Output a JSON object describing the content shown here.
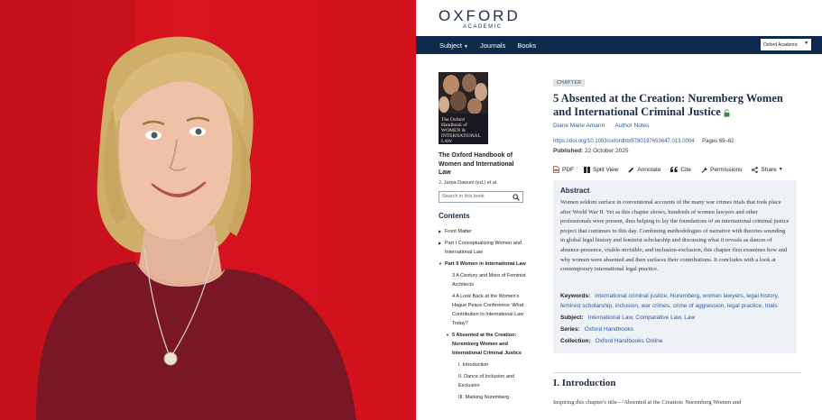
{
  "brand": {
    "logo": "OXFORD",
    "logo_sub": "ACADEMIC"
  },
  "nav": {
    "subject": "Subject",
    "journals": "Journals",
    "books": "Books",
    "site_select": "Oxford Academic"
  },
  "book": {
    "cover_title": "The Oxford Handbook of WOMEN & INTERNATIONAL LAW",
    "title": "The Oxford Handbook of Women and International Law",
    "editors": "J. Jarpa Dawuni (ed.) et al."
  },
  "search": {
    "placeholder": "Search in this book"
  },
  "contents": {
    "heading": "Contents",
    "front_matter": "Front Matter",
    "part1": "Part I  Conceptualizing Women and International Law",
    "part2": "Part II  Women in International Law",
    "ch3": "3  A Century and More of Feminist Architects",
    "ch4": "4  A Look Back at the Women's Hague Peace Conference: What Contribution to International Law Today?",
    "ch5": "5  Absented at the Creation: Nuremberg Women and International Criminal Justice",
    "s1": "I.  Introduction",
    "s2": "II.  Dance of Inclusion and Exclusion",
    "s3": "III.  Marking Nuremberg"
  },
  "chapter": {
    "badge": "CHAPTER",
    "title": "5  Absented at the Creation: Nuremberg Women and International Criminal Justice",
    "author": "Diane Marie Amann",
    "author_notes": "Author Notes",
    "doi": "https://doi.org/10.1093/oxfordhb/9780197653647.013.0004",
    "pages": "Pages 69–82",
    "published_label": "Published:",
    "published_date": "22 October 2025"
  },
  "toolbar": {
    "pdf": "PDF",
    "split_view": "Split View",
    "annotate": "Annotate",
    "cite": "Cite",
    "permissions": "Permissions",
    "share": "Share"
  },
  "abstract": {
    "heading": "Abstract",
    "text": "Women seldom surface in conventional accounts of the many war crimes trials that took place after World War II. Yet as this chapter shows, hundreds of women lawyers and other professionals were present, thus helping to lay the foundations of an international criminal justice project that continues to this day. Combining methodologies of narrative with theories sounding in global legal history and feminist scholarship and discussing what it reveals as dances of absence-presence, visible-invisible, and inclusion-exclusion, this chapter first examines how and why women were absented and then surfaces their contributions. It concludes with a look at contemporary international legal practice."
  },
  "meta": {
    "keywords_label": "Keywords:",
    "keywords": [
      "international criminal justice",
      "Nuremberg",
      "women lawyers",
      "legal history",
      "feminist scholarship",
      "inclusion",
      "war crimes",
      "crime of aggression",
      "legal practice",
      "trials"
    ],
    "subject_label": "Subject:",
    "subjects": [
      "International Law",
      "Comparative Law",
      "Law"
    ],
    "series_label": "Series:",
    "series": "Oxford Handbooks",
    "collection_label": "Collection:",
    "collection": "Oxford Handbooks Online"
  },
  "intro": {
    "heading": "I.  Introduction",
    "text": "Inspiring this chapter's title—'Absented at the Creation: Nuremberg Women and"
  },
  "colors": {
    "nav_bg": "#0d2a4c",
    "link": "#2a5aa0",
    "photo_bg": "#d0121d",
    "panel_bg": "#eef1f5"
  }
}
